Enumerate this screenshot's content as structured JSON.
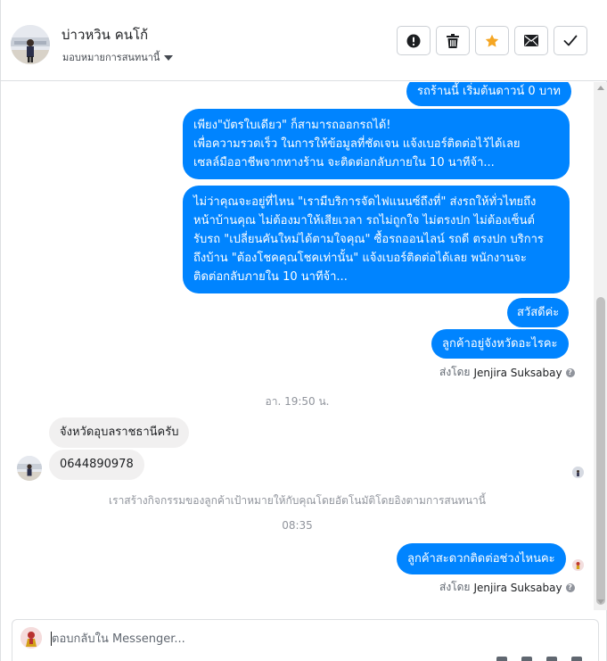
{
  "header": {
    "contact_name": "บ่าวหวิน คนโก้",
    "assign_label": "มอบหมายการสนทนานี้",
    "actions": [
      {
        "icon": "alert-icon",
        "name": "mark-spam-button"
      },
      {
        "icon": "trash-icon",
        "name": "delete-button"
      },
      {
        "icon": "star-icon",
        "name": "star-button",
        "color": "#f5a623"
      },
      {
        "icon": "envelope-icon",
        "name": "mark-unread-button"
      },
      {
        "icon": "check-icon",
        "name": "mark-done-button"
      }
    ]
  },
  "messages": {
    "out_1": "รถร้านนี้ เริ่มต้นดาวน์ 0 บาท",
    "out_2": "เพียง\"บัตรใบเดียว\" ก็สามารถออกรถได้!\nเพื่อความรวดเร็ว ในการให้ข้อมูลที่ชัดเจน แจ้งเบอร์ติดต่อไว้ได้เลย\nเซลล์มืออาชีพจากทางร้าน จะติดต่อกลับภายใน 10 นาทีจ้า...",
    "out_3": "ไม่ว่าคุณจะอยู่ที่ไหน \"เรามีบริการจัดไฟแนนซ์ถึงที่\"  ส่งรถให้ทั่วไทยถึง\nหน้าบ้านคุณ ไม่ต้องมาให้เสียเวลา รถไม่ถูกใจ ไม่ตรงปก ไม่ต้องเซ็นต์\nรับรถ \"เปลี่ยนคันใหม่ได้ตามใจคุณ\" ซื้อรถออนไลน์ รถดี ตรงปก บริการ\nถึงบ้าน \"ต้องโชคคุณโชคเท่านั้น\" แจ้งเบอร์ติดต่อได้เลย พนักงานจะ\nติดต่อกลับภายใน 10 นาทีจ้า...",
    "out_4": "สวัสดีค่ะ",
    "out_5": "ลูกค้าอยู่จังหวัดอะไรคะ",
    "sent_by_1_prefix": "ส่งโดย",
    "sent_by_1_name": "Jenjira Suksabay",
    "timestamp_1": "อา. 19:50 น.",
    "in_1": "จังหวัดอุบลราชธานีครับ",
    "in_2": "0644890978",
    "system_note": "เราสร้างกิจกรรมของลูกค้าเป้าหมายให้กับคุณโดยอัตโนมัติโดยอิงตามการสนทนานี้",
    "timestamp_2": "08:35",
    "out_6": "ลูกค้าสะดวกติดต่อช่วงไหนคะ",
    "sent_by_2_prefix": "ส่งโดย",
    "sent_by_2_name": "Jenjira Suksabay",
    "info_glyph": "?"
  },
  "composer": {
    "placeholder": "ตอบกลับใน Messenger..."
  },
  "colors": {
    "outgoing_bubble": "#0084ff",
    "incoming_bubble": "#f1f0f0",
    "star": "#f5a623"
  }
}
